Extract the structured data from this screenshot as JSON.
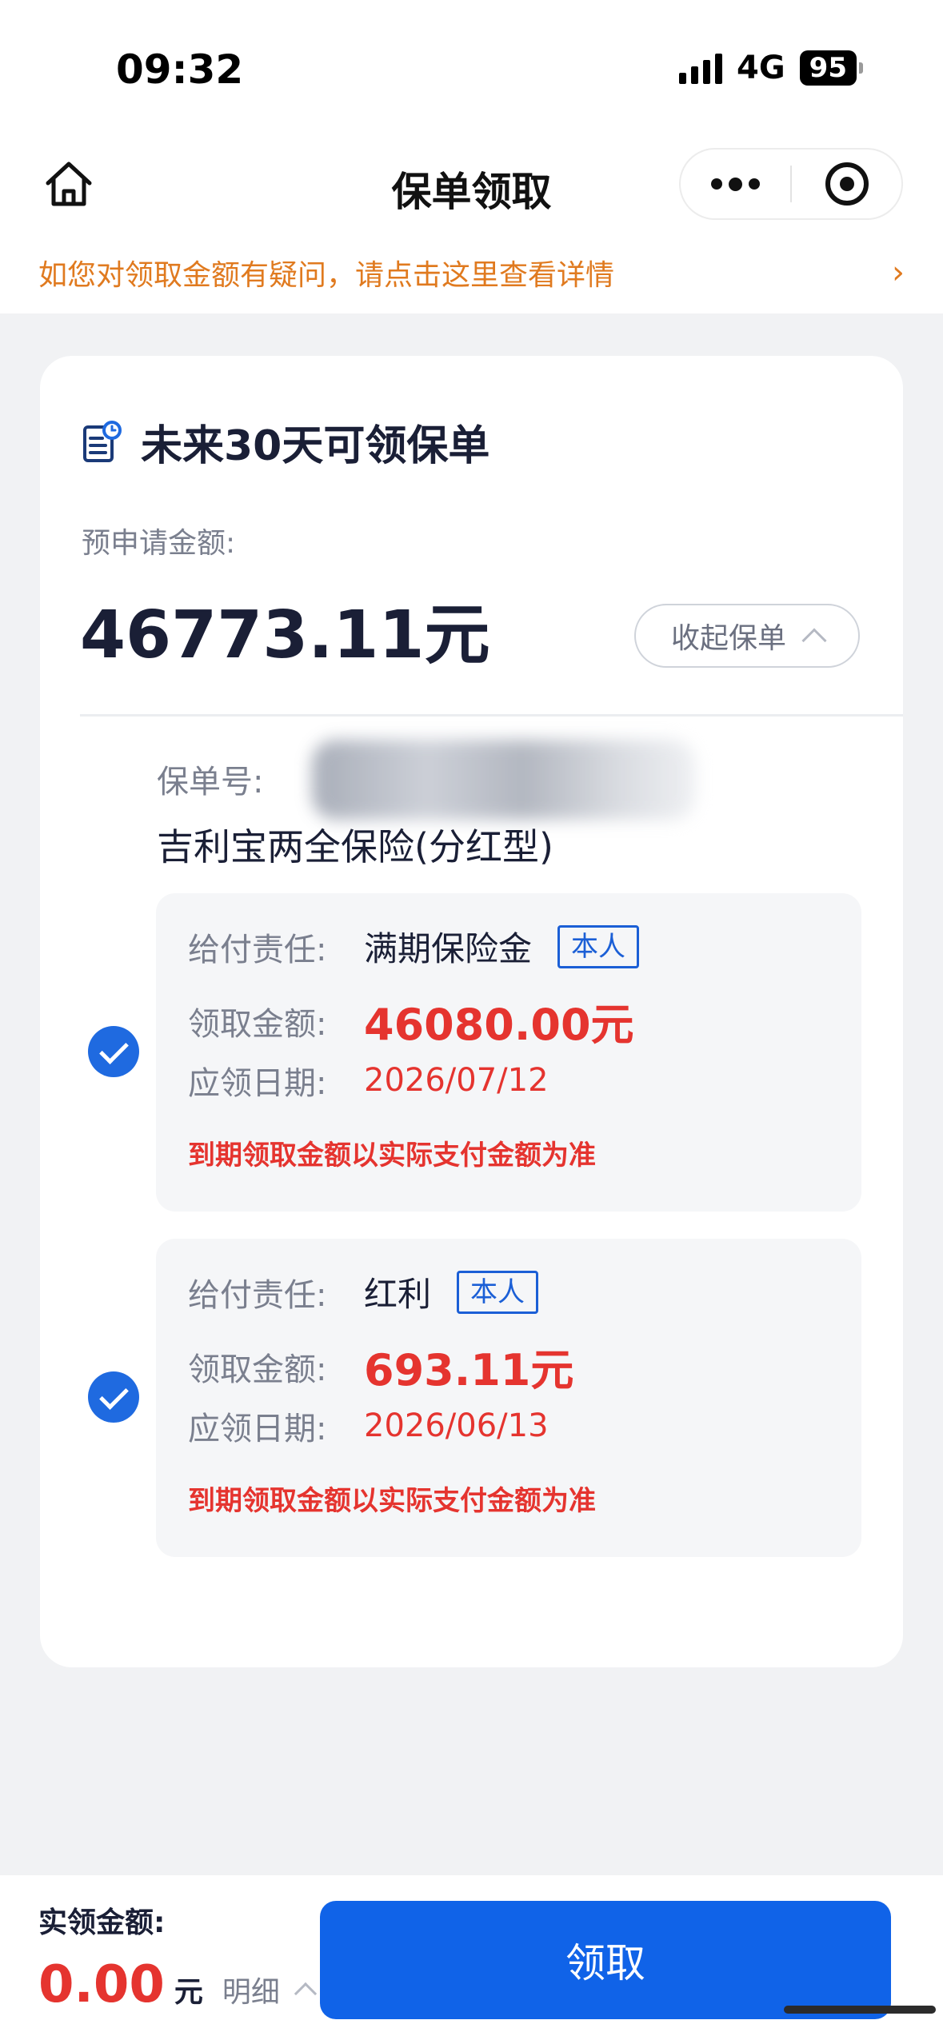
{
  "status_bar": {
    "time": "09:32",
    "network": "4G",
    "battery": "95"
  },
  "nav": {
    "title": "保单领取"
  },
  "notice": {
    "text": "如您对领取金额有疑问，请点击这里查看详情"
  },
  "card": {
    "title": "未来30天可领保单",
    "pre_amount_label": "预申请金额:",
    "pre_amount": "46773.11元",
    "collapse_label": "收起保单",
    "policy_no_label": "保单号:",
    "product_name": "吉利宝两全保险(分红型)",
    "benefits": [
      {
        "selected": true,
        "duty_label": "给付责任:",
        "duty": "满期保险金",
        "tag": "本人",
        "amount_label": "领取金额:",
        "amount": "46080.00元",
        "date_label": "应领日期:",
        "date": "2026/07/12",
        "note": "到期领取金额以实际支付金额为准"
      },
      {
        "selected": true,
        "duty_label": "给付责任:",
        "duty": "红利",
        "tag": "本人",
        "amount_label": "领取金额:",
        "amount": "693.11元",
        "date_label": "应领日期:",
        "date": "2026/06/13",
        "note": "到期领取金额以实际支付金额为准"
      }
    ]
  },
  "bottom": {
    "actual_label": "实领金额:",
    "actual_amount": "0.00",
    "actual_unit": "元",
    "detail_label": "明细",
    "claim_label": "领取"
  },
  "colors": {
    "accent": "#1063e8",
    "warning": "#e07a1f",
    "amount_red": "#e5342f"
  }
}
